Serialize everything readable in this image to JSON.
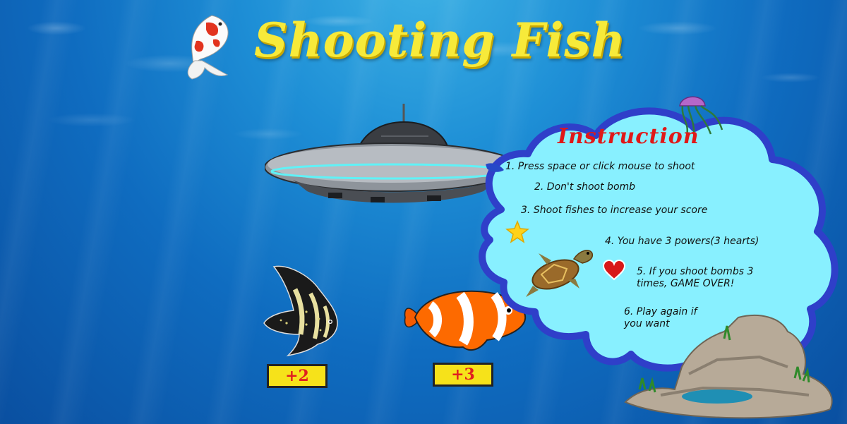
{
  "game": {
    "title": "Shooting Fish",
    "scores": {
      "angelfish": "+2",
      "clownfish": "+3"
    }
  },
  "instructions": {
    "heading": "Instruction",
    "items": [
      "1. Press space or click mouse to shoot",
      "2. Don't shoot bomb",
      "3.  Shoot fishes to increase your score",
      "4. You have 3 powers(3 hearts)",
      "5. If you shoot bombs 3 times, GAME OVER!",
      "6. Play again if you want"
    ]
  },
  "icons": {
    "star": "star-icon",
    "heart": "heart-icon",
    "turtle": "turtle-icon",
    "jellyfish": "jellyfish-icon",
    "koi": "koi-icon",
    "ufo": "ufo-icon",
    "rocks": "rocks-icon"
  },
  "colors": {
    "title": "#f7ea3a",
    "heading": "#e01818",
    "badge_bg": "#f6e21a",
    "badge_text": "#e02020",
    "cloud_fill": "#88f0ff",
    "cloud_border": "#2f3fc9"
  }
}
